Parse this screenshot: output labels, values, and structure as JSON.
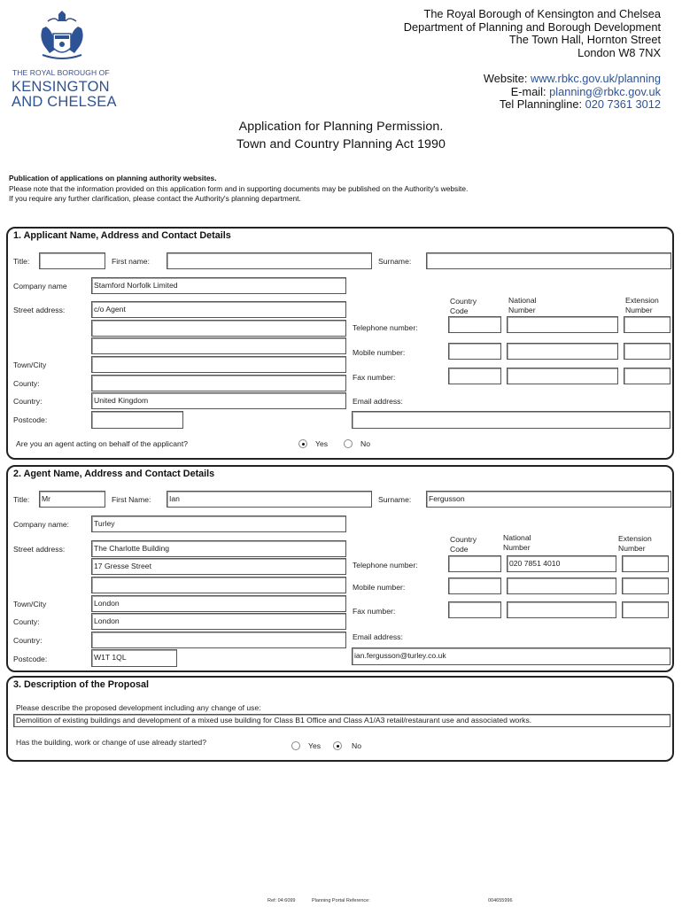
{
  "logo": {
    "small_text": "THE ROYAL BOROUGH OF",
    "line1": "KENSINGTON",
    "line2": "AND CHELSEA",
    "brand_color": "#2d5295"
  },
  "address": {
    "lines": [
      "The Royal Borough of Kensington and Chelsea",
      "Department of Planning and Borough Development",
      "The Town Hall, Hornton Street",
      "London W8 7NX"
    ],
    "website_label": "Website:",
    "website": "www.rbkc.gov.uk/planning",
    "email_label": "E-mail:",
    "email": "planning@rbkc.gov.uk",
    "phone_label": "Tel Planningline:",
    "phone": "020 7361 3012"
  },
  "title": {
    "line1": "Application for Planning Permission.",
    "line2": "Town and Country Planning Act 1990"
  },
  "publication": {
    "heading": "Publication of applications on planning authority websites.",
    "line1": "Please note that the information provided on this application form and in supporting documents may be published on the Authority's website.",
    "line2": "If you require any further clarification, please contact the Authority's planning department."
  },
  "section1": {
    "title": "1.  Applicant Name, Address and Contact Details",
    "labels": {
      "title": "Title:",
      "first_name": "First name:",
      "surname": "Surname:",
      "company": "Company name",
      "street": "Street address:",
      "town": "Town/City",
      "county": "County:",
      "country": "Country:",
      "postcode": "Postcode:",
      "country_code": "Country Code",
      "national_number": "National Number",
      "extension": "Extension Number",
      "telephone": "Telephone number:",
      "mobile": "Mobile number:",
      "fax": "Fax number:",
      "email": "Email address:"
    },
    "values": {
      "title": "",
      "first_name": "",
      "surname": "",
      "company": "Stamford Norfolk Limited",
      "street1": "c/o Agent",
      "street2": "",
      "street3": "",
      "town": "",
      "county": "",
      "country": "United Kingdom",
      "postcode": "",
      "tel_cc": "",
      "tel_nat": "",
      "tel_ext": "",
      "mob_cc": "",
      "mob_nat": "",
      "mob_ext": "",
      "fax_cc": "",
      "fax_nat": "",
      "fax_ext": "",
      "email": ""
    },
    "agent_question": "Are you an agent acting on behalf of the applicant?",
    "yes_label": "Yes",
    "no_label": "No",
    "agent_answer": "Yes"
  },
  "section2": {
    "title": "2.  Agent Name, Address and Contact Details",
    "labels": {
      "title": "Title:",
      "first_name": "First Name:",
      "surname": "Surname:",
      "company": "Company name:",
      "street": "Street address:",
      "town": "Town/City",
      "county": "County:",
      "country": "Country:",
      "postcode": "Postcode:",
      "country_code": "Country Code",
      "national_number": "National Number",
      "extension": "Extension Number",
      "telephone": "Telephone number:",
      "mobile": "Mobile number:",
      "fax": "Fax number:",
      "email": "Email address:"
    },
    "values": {
      "title": "Mr",
      "first_name": "Ian",
      "surname": "Fergusson",
      "company": "Turley",
      "street1": "The Charlotte Building",
      "street2": "17 Gresse Street",
      "street3": "",
      "town": "London",
      "county": "London",
      "country": "",
      "postcode": "W1T 1QL",
      "tel_cc": "",
      "tel_nat": "020 7851 4010",
      "tel_ext": "",
      "mob_cc": "",
      "mob_nat": "",
      "mob_ext": "",
      "fax_cc": "",
      "fax_nat": "",
      "fax_ext": "",
      "email": "ian.fergusson@turley.co.uk"
    }
  },
  "section3": {
    "title": "3.  Description of the Proposal",
    "prompt": "Please describe the proposed development including any change of use:",
    "description": "Demolition of existing buildings and development of a mixed use building for Class B1 Office and Class A1/A3 retail/restaurant use and associated works.",
    "started_question": "Has the building, work or change of use already started?",
    "yes_label": "Yes",
    "no_label": "No",
    "started_answer": "No"
  },
  "footer": {
    "ref": "Ref: 04:6099",
    "portal_label": "Planning Portal Reference:",
    "portal_ref": "004655996"
  }
}
